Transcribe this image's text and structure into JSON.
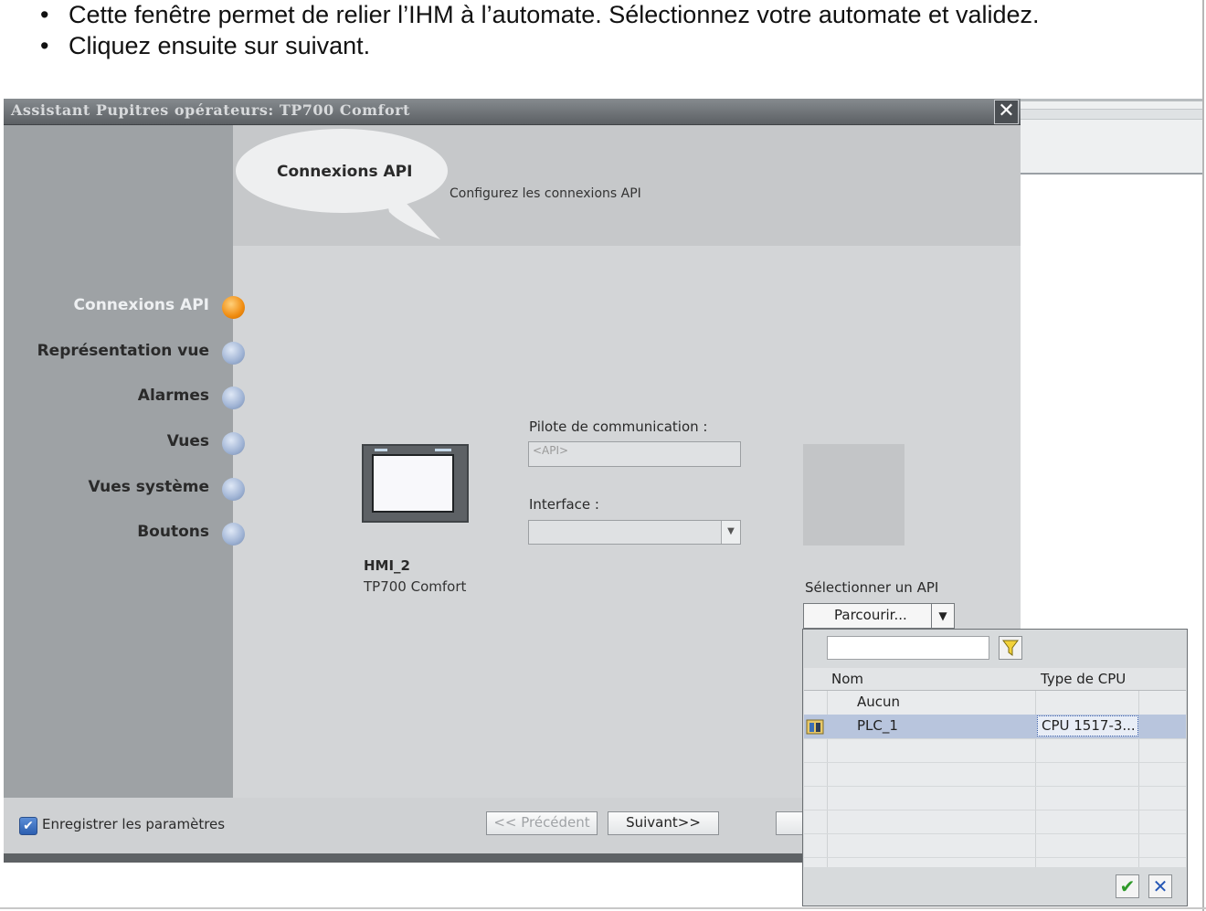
{
  "instructions": [
    "Cette fenêtre permet de relier l’IHM à l’automate. Sélectionnez votre automate et validez.",
    "Cliquez ensuite sur suivant."
  ],
  "dialog": {
    "title": "Assistant Pupitres opérateurs: TP700 Comfort",
    "close_icon": "✕",
    "header": {
      "title": "Connexions API",
      "subtitle": "Configurez les connexions API"
    },
    "nav": [
      {
        "label": "Connexions API",
        "active": true
      },
      {
        "label": "Représentation vue",
        "active": false
      },
      {
        "label": "Alarmes",
        "active": false
      },
      {
        "label": "Vues",
        "active": false
      },
      {
        "label": "Vues système",
        "active": false
      },
      {
        "label": "Boutons",
        "active": false
      }
    ],
    "device": {
      "name": "HMI_2",
      "type": "TP700 Comfort"
    },
    "driver": {
      "label": "Pilote de communication :",
      "value": "<API>"
    },
    "interface": {
      "label": "Interface :",
      "value": ""
    },
    "select_plc": {
      "label": "Sélectionner un API",
      "browse_label": "Parcourir..."
    },
    "footer": {
      "save_settings_label": "Enregistrer les paramètres",
      "save_settings_checked": true,
      "previous_label": "<< Précédent",
      "next_label": "Suivant>>"
    }
  },
  "plc_popup": {
    "filter_value": "",
    "columns": [
      "Nom",
      "Type de CPU"
    ],
    "rows": [
      {
        "name": "Aucun",
        "cpu": "",
        "selected": false
      },
      {
        "name": "PLC_1",
        "cpu": "CPU 1517-3...",
        "selected": true
      }
    ],
    "ok_icon": "✔",
    "cancel_icon": "✕"
  },
  "colors": {
    "active_dot": "#f08c10",
    "inactive_dot": "#9fb3d4",
    "selection": "#b8c5dd"
  }
}
